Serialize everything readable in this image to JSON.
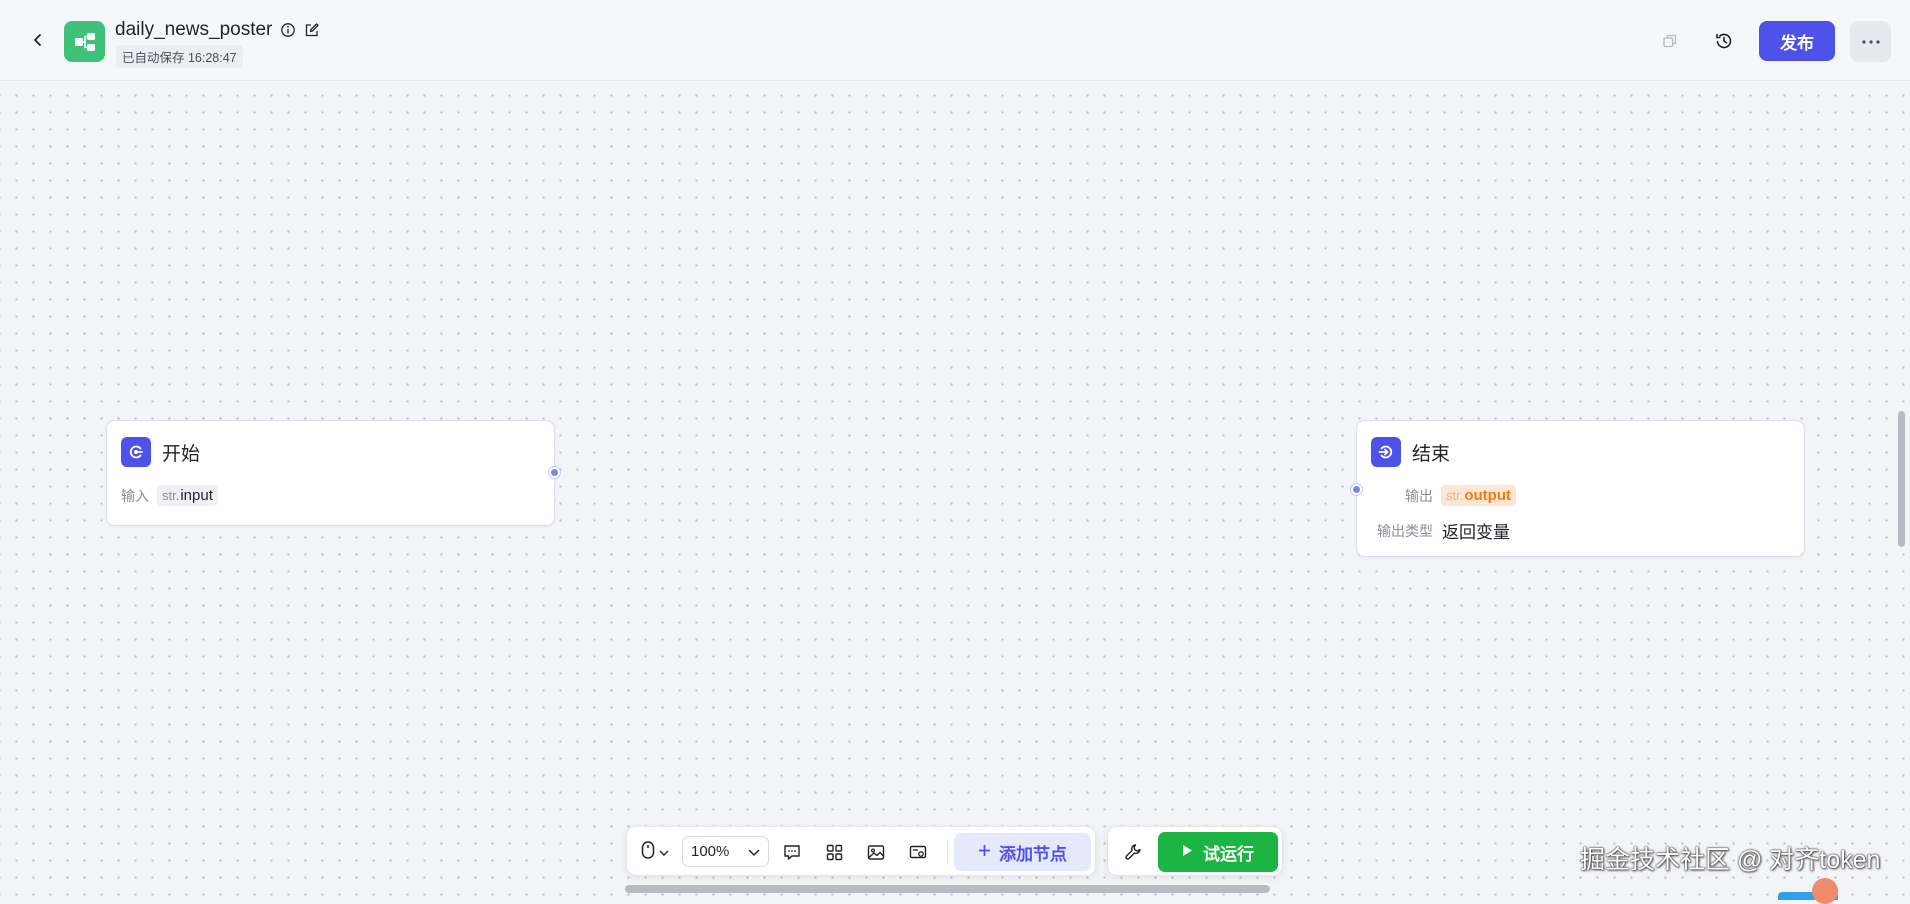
{
  "header": {
    "title": "daily_news_poster",
    "autosave": "已自动保存 16:28:47",
    "publish_label": "发布"
  },
  "nodes": {
    "start": {
      "title": "开始",
      "input_label": "输入",
      "input_type": "str.",
      "input_name": "input"
    },
    "end": {
      "title": "结束",
      "output_label": "输出",
      "output_type": "str.",
      "output_name": "output",
      "output_type_label": "输出类型",
      "output_type_value": "返回变量"
    }
  },
  "toolbar": {
    "zoom": "100%",
    "add_node_label": "添加节点",
    "run_label": "试运行"
  },
  "watermark": "掘金技术社区 @ 对齐token",
  "colors": {
    "accent": "#4d53e8",
    "run": "#1cb543",
    "app_icon": "#3ec27a"
  },
  "icons": [
    "back-icon",
    "workflow-icon",
    "info-icon",
    "edit-icon",
    "copy-icon",
    "history-icon",
    "more-icon",
    "mouse-icon",
    "comment-icon",
    "grid-icon",
    "image-icon",
    "screen-icon",
    "plus-icon",
    "wrench-icon",
    "play-icon",
    "start-node-icon",
    "end-node-icon"
  ]
}
